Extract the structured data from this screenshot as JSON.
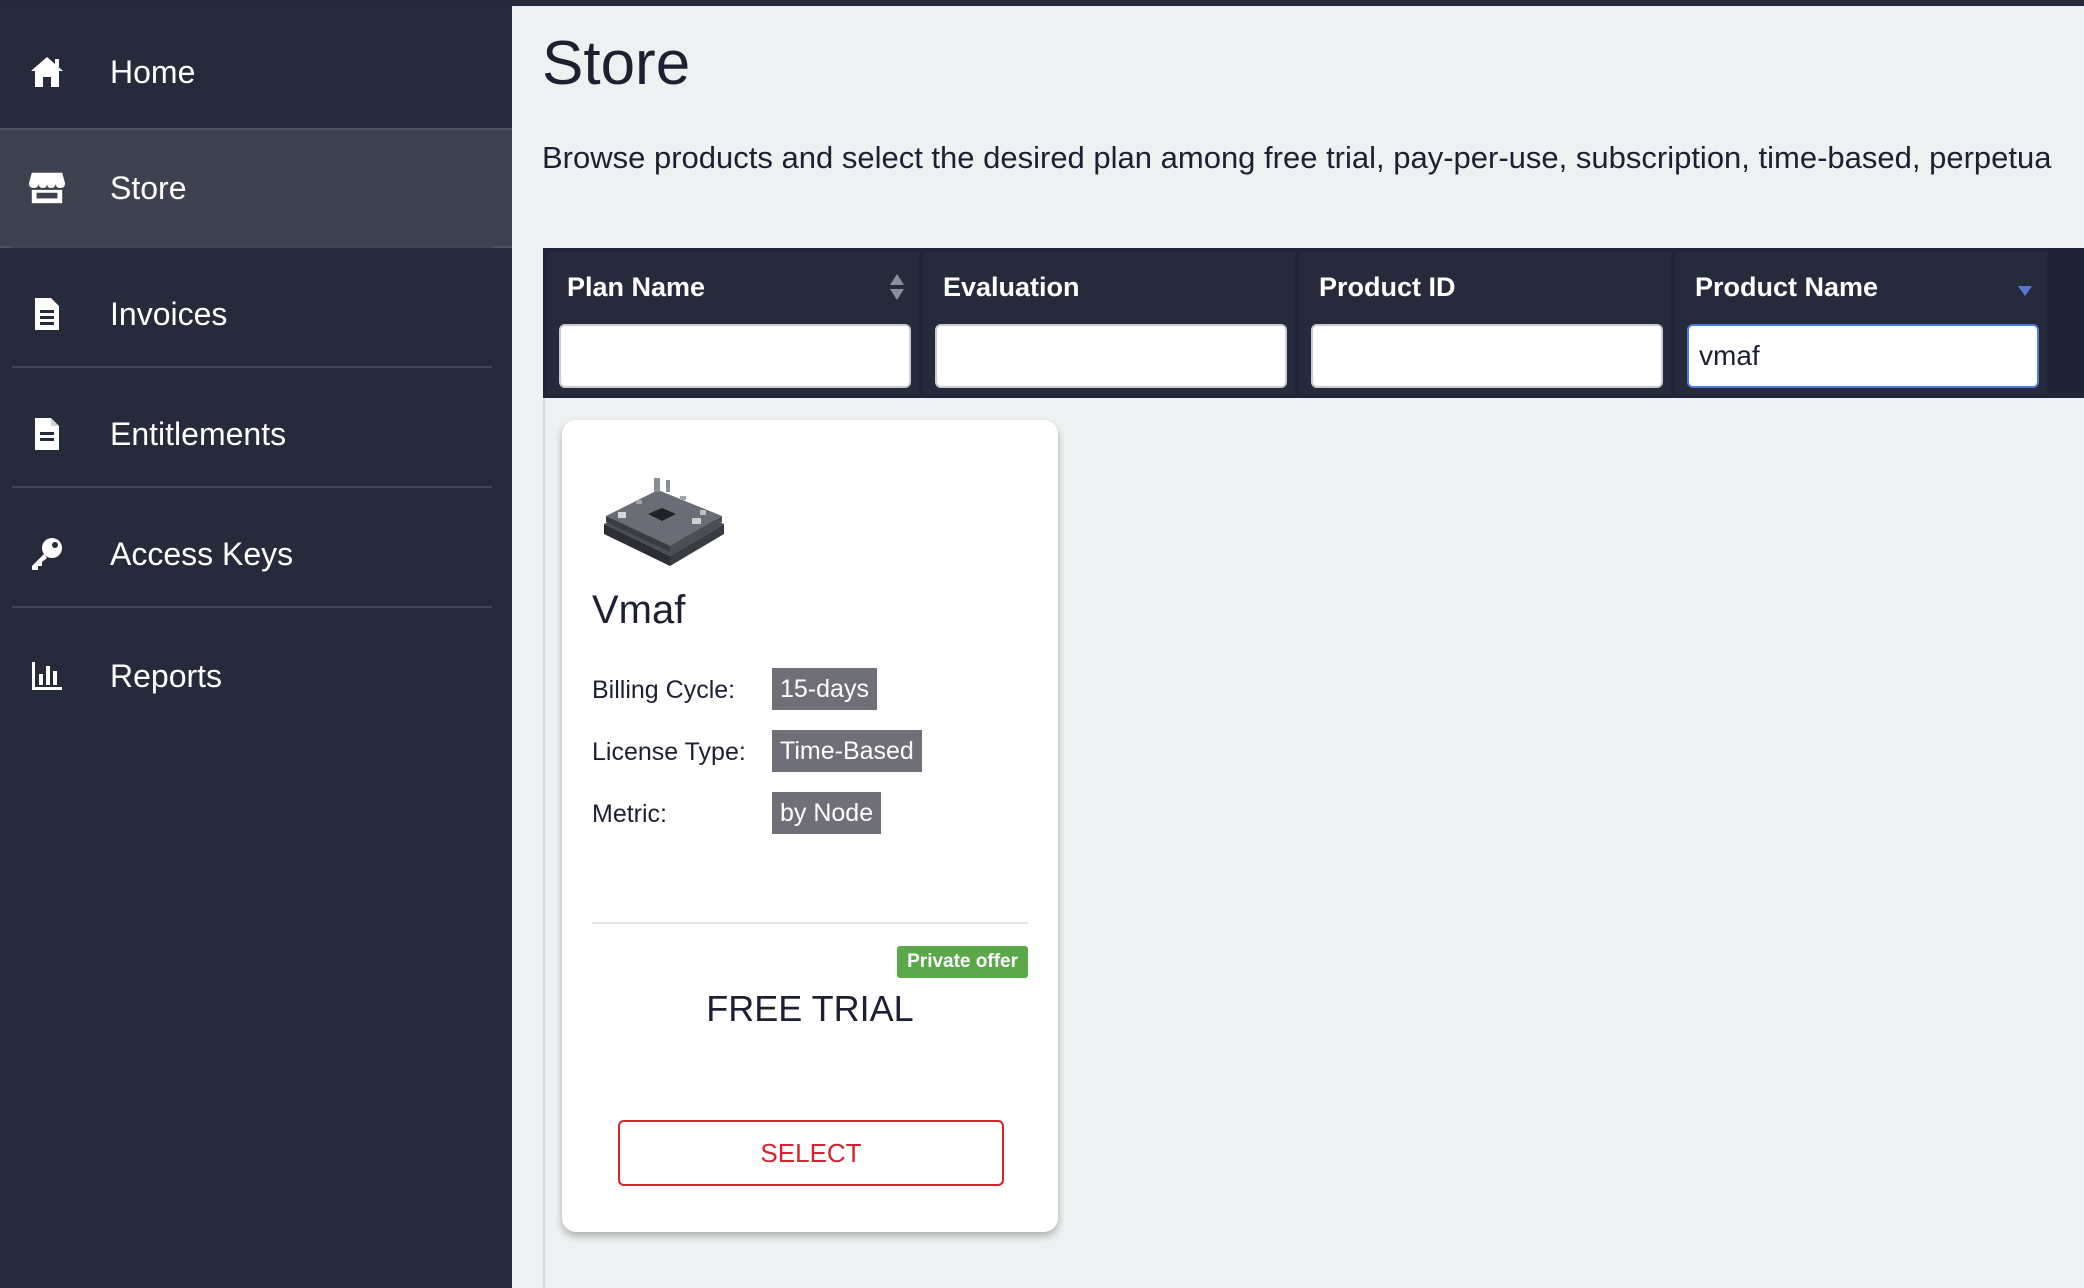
{
  "sidebar": {
    "items": [
      {
        "label": "Home",
        "icon": "home-icon"
      },
      {
        "label": "Store",
        "icon": "store-icon",
        "active": true
      },
      {
        "label": "Invoices",
        "icon": "invoice-icon"
      },
      {
        "label": "Entitlements",
        "icon": "document-icon"
      },
      {
        "label": "Access Keys",
        "icon": "key-icon"
      },
      {
        "label": "Reports",
        "icon": "bar-chart-icon"
      }
    ]
  },
  "main": {
    "title": "Store",
    "description": "Browse products and select the desired plan among free trial, pay-per-use, subscription, time-based, perpetua"
  },
  "filters": [
    {
      "header": "Plan Name",
      "value": ""
    },
    {
      "header": "Evaluation",
      "value": ""
    },
    {
      "header": "Product ID",
      "value": ""
    },
    {
      "header": "Product Name",
      "value": "vmaf"
    }
  ],
  "product_card": {
    "image_icon": "circuit-board-image",
    "name": "Vmaf",
    "attributes": [
      {
        "label": "Billing Cycle:",
        "value": "15-days"
      },
      {
        "label": "License Type:",
        "value": "Time-Based"
      },
      {
        "label": "Metric:",
        "value": "by Node"
      }
    ],
    "offer_badge": "Private offer",
    "plan_type": "FREE TRIAL",
    "select_label": "SELECT"
  },
  "colors": {
    "sidebar_bg": "#252b3b",
    "active_item_bg": "#3c4250",
    "page_bg": "#eef1f2",
    "badge_gray": "#6f6f78",
    "offer_green": "#5aa84a",
    "select_red": "#d4232c"
  }
}
